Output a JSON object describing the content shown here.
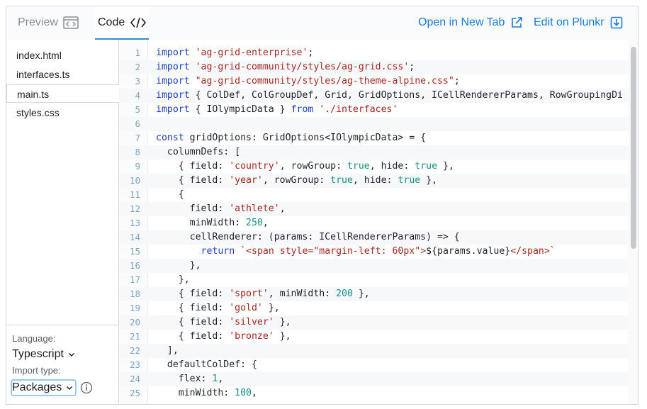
{
  "tabs": {
    "preview": "Preview",
    "code": "Code"
  },
  "links": {
    "open_new_tab": "Open in New Tab",
    "edit_plunkr": "Edit on Plunkr"
  },
  "files": [
    "index.html",
    "interfaces.ts",
    "main.ts",
    "styles.css"
  ],
  "active_file": "main.ts",
  "options": {
    "language_label": "Language:",
    "language_value": "Typescript",
    "import_label": "Import type:",
    "import_value": "Packages"
  },
  "code_lines": [
    [
      [
        "k",
        "import"
      ],
      [
        "p",
        " "
      ],
      [
        "s",
        "'ag-grid-enterprise'"
      ],
      [
        "p",
        ";"
      ]
    ],
    [
      [
        "k",
        "import"
      ],
      [
        "p",
        " "
      ],
      [
        "s",
        "'ag-grid-community/styles/ag-grid.css'"
      ],
      [
        "p",
        ";"
      ]
    ],
    [
      [
        "k",
        "import"
      ],
      [
        "p",
        " "
      ],
      [
        "s",
        "\"ag-grid-community/styles/ag-theme-alpine.css\""
      ],
      [
        "p",
        ";"
      ]
    ],
    [
      [
        "k",
        "import"
      ],
      [
        "p",
        " { ColDef, ColGroupDef, Grid, GridOptions, ICellRendererParams, RowGroupingDi"
      ]
    ],
    [
      [
        "k",
        "import"
      ],
      [
        "p",
        " { IOlympicData } "
      ],
      [
        "k",
        "from"
      ],
      [
        "p",
        " "
      ],
      [
        "s",
        "'./interfaces'"
      ]
    ],
    [
      [
        "p",
        ""
      ]
    ],
    [
      [
        "k",
        "const"
      ],
      [
        "p",
        " gridOptions: GridOptions<IOlympicData> = {"
      ]
    ],
    [
      [
        "p",
        "  columnDefs: ["
      ]
    ],
    [
      [
        "p",
        "    { field: "
      ],
      [
        "s",
        "'country'"
      ],
      [
        "p",
        ", rowGroup: "
      ],
      [
        "n",
        "true"
      ],
      [
        "p",
        ", hide: "
      ],
      [
        "n",
        "true"
      ],
      [
        "p",
        " },"
      ]
    ],
    [
      [
        "p",
        "    { field: "
      ],
      [
        "s",
        "'year'"
      ],
      [
        "p",
        ", rowGroup: "
      ],
      [
        "n",
        "true"
      ],
      [
        "p",
        ", hide: "
      ],
      [
        "n",
        "true"
      ],
      [
        "p",
        " },"
      ]
    ],
    [
      [
        "p",
        "    {"
      ]
    ],
    [
      [
        "p",
        "      field: "
      ],
      [
        "s",
        "'athlete'"
      ],
      [
        "p",
        ","
      ]
    ],
    [
      [
        "p",
        "      minWidth: "
      ],
      [
        "n",
        "250"
      ],
      [
        "p",
        ","
      ]
    ],
    [
      [
        "p",
        "      cellRenderer: (params: ICellRendererParams) => {"
      ]
    ],
    [
      [
        "p",
        "        "
      ],
      [
        "k",
        "return"
      ],
      [
        "p",
        " "
      ],
      [
        "s",
        "`<span style=\"margin-left: 60px\">"
      ],
      [
        "p",
        "${params.value}"
      ],
      [
        "s",
        "</span>`"
      ]
    ],
    [
      [
        "p",
        "      },"
      ]
    ],
    [
      [
        "p",
        "    },"
      ]
    ],
    [
      [
        "p",
        "    { field: "
      ],
      [
        "s",
        "'sport'"
      ],
      [
        "p",
        ", minWidth: "
      ],
      [
        "n",
        "200"
      ],
      [
        "p",
        " },"
      ]
    ],
    [
      [
        "p",
        "    { field: "
      ],
      [
        "s",
        "'gold'"
      ],
      [
        "p",
        " },"
      ]
    ],
    [
      [
        "p",
        "    { field: "
      ],
      [
        "s",
        "'silver'"
      ],
      [
        "p",
        " },"
      ]
    ],
    [
      [
        "p",
        "    { field: "
      ],
      [
        "s",
        "'bronze'"
      ],
      [
        "p",
        " },"
      ]
    ],
    [
      [
        "p",
        "  ],"
      ]
    ],
    [
      [
        "p",
        "  defaultColDef: {"
      ]
    ],
    [
      [
        "p",
        "    flex: "
      ],
      [
        "n",
        "1"
      ],
      [
        "p",
        ","
      ]
    ],
    [
      [
        "p",
        "    minWidth: "
      ],
      [
        "n",
        "100"
      ],
      [
        "p",
        ","
      ]
    ]
  ],
  "icons": {
    "preview": "browser-code-icon",
    "open_new_tab": "external-link-icon",
    "edit_plunkr": "download-box-icon",
    "language": "chevron-down-icon",
    "import": "chevron-down-icon",
    "info": "info-circle-icon"
  },
  "colors": {
    "link": "#1b7bd4",
    "keyword": "#1a3fb8",
    "string": "#a3271f",
    "number": "#1a8f8a"
  }
}
